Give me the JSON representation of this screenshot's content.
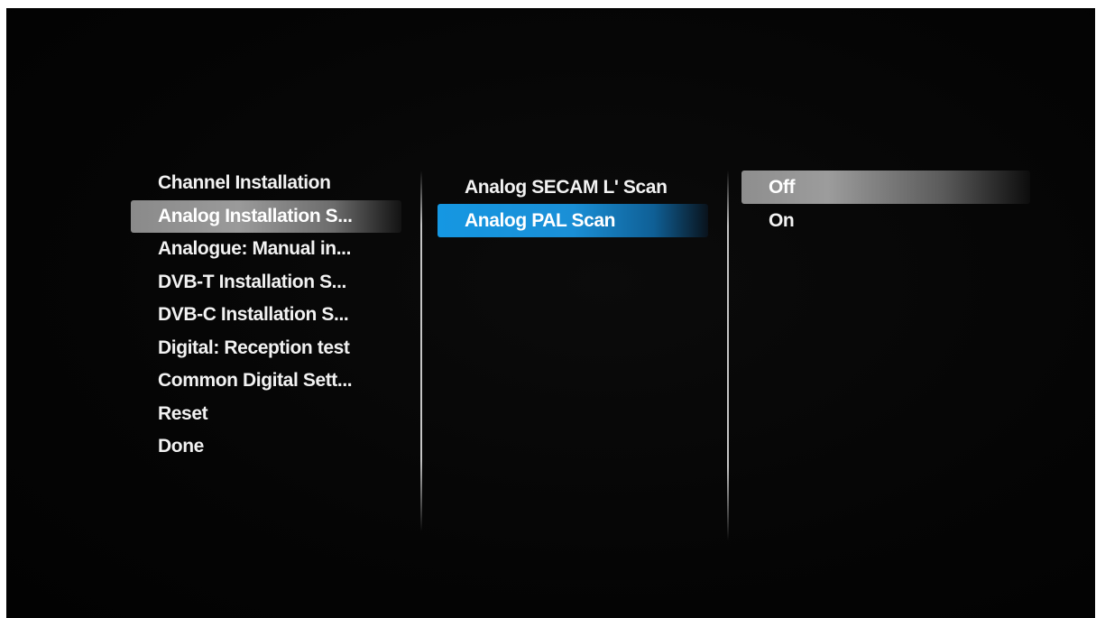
{
  "installation_menu": {
    "items": [
      {
        "label": "Channel Installation"
      },
      {
        "label": "Analog Installation S..."
      },
      {
        "label": "Analogue: Manual in..."
      },
      {
        "label": "DVB-T Installation S..."
      },
      {
        "label": "DVB-C Installation S..."
      },
      {
        "label": "Digital: Reception test"
      },
      {
        "label": "Common Digital Sett..."
      },
      {
        "label": "Reset"
      },
      {
        "label": "Done"
      }
    ],
    "selected_index": 1
  },
  "analog_submenu": {
    "items": [
      {
        "label": "Analog SECAM L' Scan"
      },
      {
        "label": "Analog PAL Scan"
      }
    ],
    "selected_index": 1
  },
  "option_menu": {
    "items": [
      {
        "label": "Off"
      },
      {
        "label": "On"
      }
    ],
    "selected_index": 0
  },
  "colors": {
    "highlight_blue": "#1597e2",
    "highlight_grey": "#8a8a8a",
    "text": "#f2f2f2",
    "background": "#050505"
  }
}
